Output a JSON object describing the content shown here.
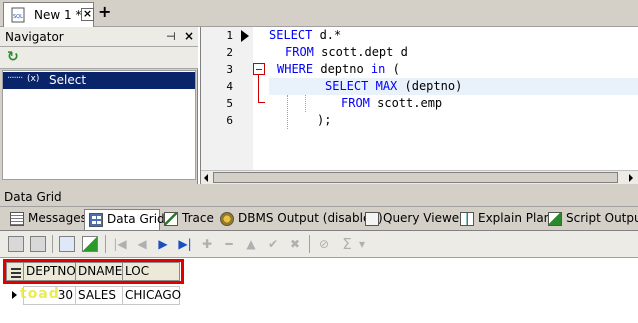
{
  "document_tab": {
    "label": "New 1 *",
    "close": "×",
    "new_tab": "+",
    "icon": "sql-file-icon"
  },
  "navigator": {
    "title": "Navigator",
    "pin_glyph": "⊣",
    "close_glyph": "×",
    "refresh_glyph": "↻",
    "item": {
      "dots": "·······",
      "icon_text": "(x)",
      "label": "Select"
    }
  },
  "editor": {
    "line_numbers": [
      "1",
      "2",
      "3",
      "4",
      "5",
      "6"
    ],
    "lines": [
      {
        "kw1": "SELECT",
        "text1": " d.*"
      },
      {
        "kw1": "FROM",
        "text1": " scott.dept d"
      },
      {
        "kw1": "WHERE",
        "text1": " deptno ",
        "kw2": "in",
        "text2": " ("
      },
      {
        "kw1": "SELECT",
        "text1": " ",
        "kw2": "MAX",
        "text2": " (deptno)"
      },
      {
        "kw1": "FROM",
        "text1": " scott.emp"
      },
      {
        "text1": ");"
      }
    ]
  },
  "data_grid_panel": {
    "title": "Data Grid",
    "tabs": [
      {
        "label": "Messages",
        "icon": "messages-icon"
      },
      {
        "label": "Data Grid",
        "icon": "data-grid-icon"
      },
      {
        "label": "Trace",
        "icon": "trace-icon"
      },
      {
        "label": "DBMS Output (disabled)",
        "icon": "dbms-output-icon"
      },
      {
        "label": "Query Viewer",
        "icon": "query-viewer-icon"
      },
      {
        "label": "Explain Plan",
        "icon": "explain-plan-icon"
      },
      {
        "label": "Script Output",
        "icon": "script-output-icon"
      }
    ],
    "toolbar_glyphs": {
      "first": "|◀",
      "prev": "◀",
      "next": "▶",
      "last": "▶|",
      "insert": "✚",
      "delete": "━",
      "up": "▲",
      "post": "✔",
      "cancel": "✖",
      "clear": "⊘",
      "sum": "Σ",
      "dropdown": "▾"
    }
  },
  "grid": {
    "columns": [
      "DEPTNO",
      "DNAME",
      "LOC"
    ],
    "rows": [
      {
        "DEPTNO": "30",
        "DNAME": "SALES",
        "LOC": "CHICAGO"
      }
    ]
  },
  "watermark": "toad",
  "highlight_color": "#e00000"
}
